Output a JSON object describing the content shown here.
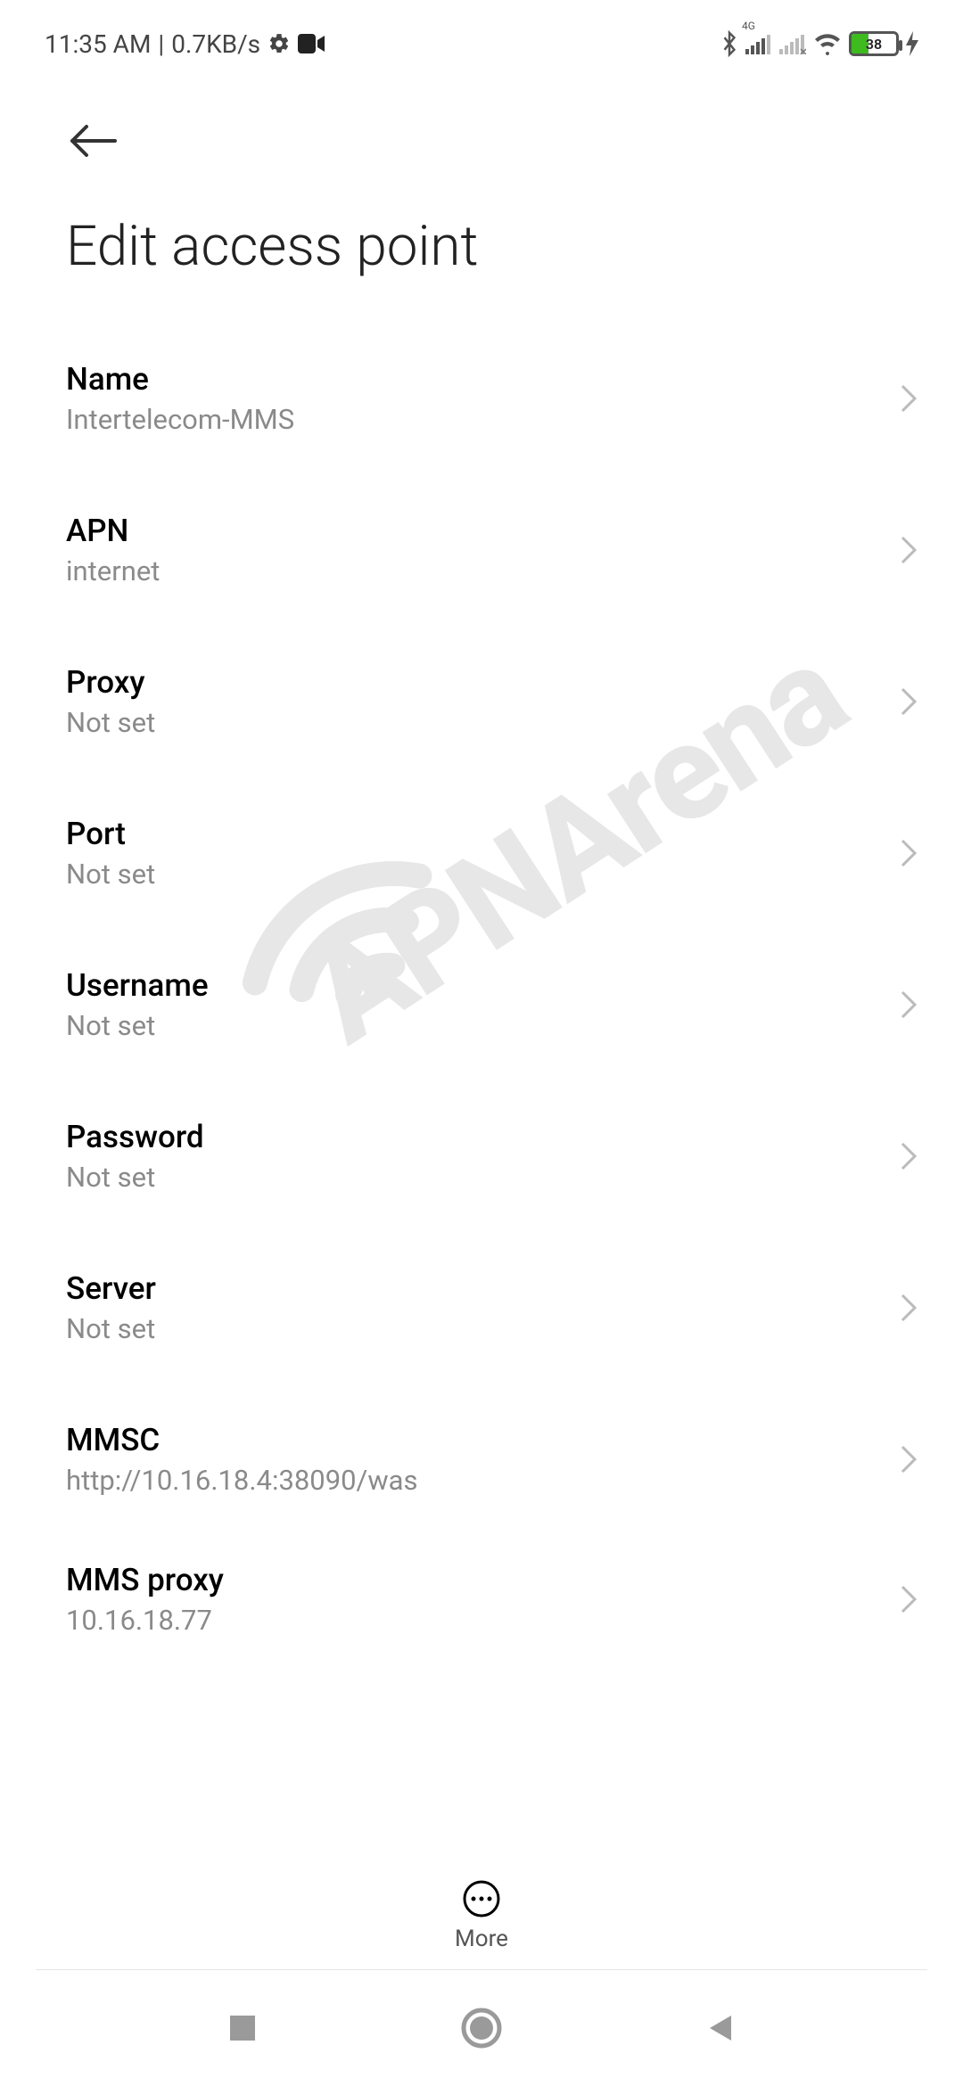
{
  "status": {
    "time": "11:35 AM",
    "speed": "0.7KB/s",
    "network_label": "4G",
    "battery_percent": "38"
  },
  "header": {
    "title": "Edit access point"
  },
  "rows": [
    {
      "label": "Name",
      "value": "Intertelecom-MMS"
    },
    {
      "label": "APN",
      "value": "internet"
    },
    {
      "label": "Proxy",
      "value": "Not set"
    },
    {
      "label": "Port",
      "value": "Not set"
    },
    {
      "label": "Username",
      "value": "Not set"
    },
    {
      "label": "Password",
      "value": "Not set"
    },
    {
      "label": "Server",
      "value": "Not set"
    },
    {
      "label": "MMSC",
      "value": "http://10.16.18.4:38090/was"
    },
    {
      "label": "MMS proxy",
      "value": "10.16.18.77"
    }
  ],
  "bottom_action": {
    "label": "More"
  },
  "watermark": {
    "text": "APNArena"
  }
}
